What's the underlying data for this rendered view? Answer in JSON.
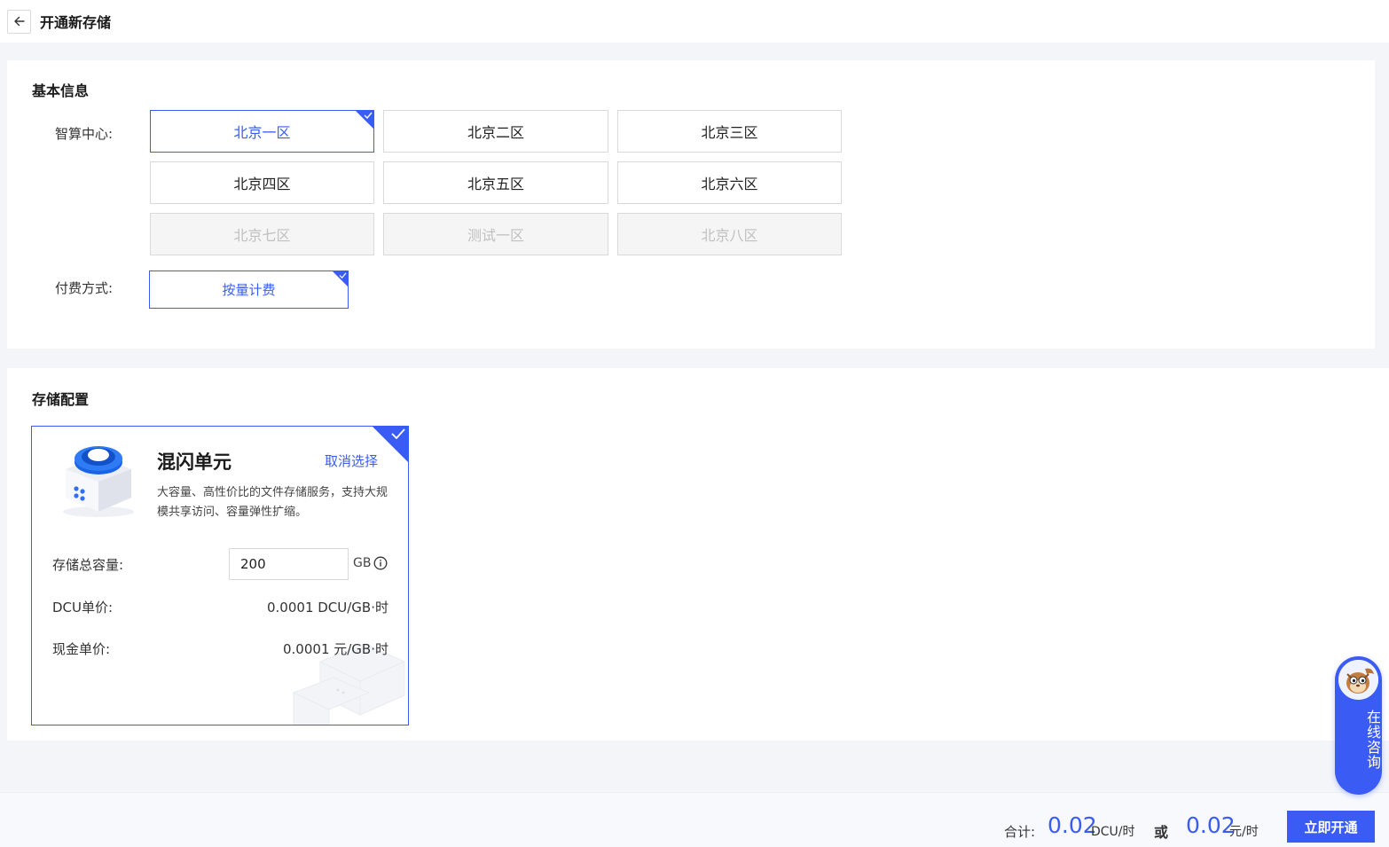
{
  "header": {
    "title": "开通新存储"
  },
  "basic": {
    "title": "基本信息",
    "center_label": "智算中心:",
    "regions": [
      {
        "label": "北京一区",
        "state": "selected"
      },
      {
        "label": "北京二区",
        "state": "normal"
      },
      {
        "label": "北京三区",
        "state": "normal"
      },
      {
        "label": "北京四区",
        "state": "normal"
      },
      {
        "label": "北京五区",
        "state": "normal"
      },
      {
        "label": "北京六区",
        "state": "normal"
      },
      {
        "label": "北京七区",
        "state": "disabled"
      },
      {
        "label": "测试一区",
        "state": "disabled"
      },
      {
        "label": "北京八区",
        "state": "disabled"
      }
    ],
    "pay_label": "付费方式:",
    "pay_option": "按量计费"
  },
  "storage": {
    "title": "存储配置",
    "card": {
      "name": "混闪单元",
      "cancel": "取消选择",
      "description": "大容量、高性价比的文件存储服务，支持大规模共享访问、容量弹性扩缩。",
      "capacity_label": "存储总容量:",
      "capacity_value": "200",
      "capacity_unit": "GB",
      "dcu_label": "DCU单价:",
      "dcu_value": "0.0001 DCU/GB·时",
      "cash_label": "现金单价:",
      "cash_value": "0.0001 元/GB·时"
    }
  },
  "footer": {
    "total_label": "合计:",
    "dcu_amount": "0.02",
    "dcu_unit": "DCU/时",
    "or": "或",
    "cash_amount": "0.02",
    "cash_unit": "元/时",
    "submit": "立即开通"
  },
  "consult": {
    "label": "在线咨询"
  },
  "colors": {
    "accent": "#3b5bf5",
    "disabled_bg": "#f5f5f5",
    "page_bg": "#f3f5f9"
  },
  "icons": [
    "arrow-left-icon",
    "check-icon",
    "info-icon",
    "storage-device-icon",
    "consult-avatar-icon"
  ]
}
